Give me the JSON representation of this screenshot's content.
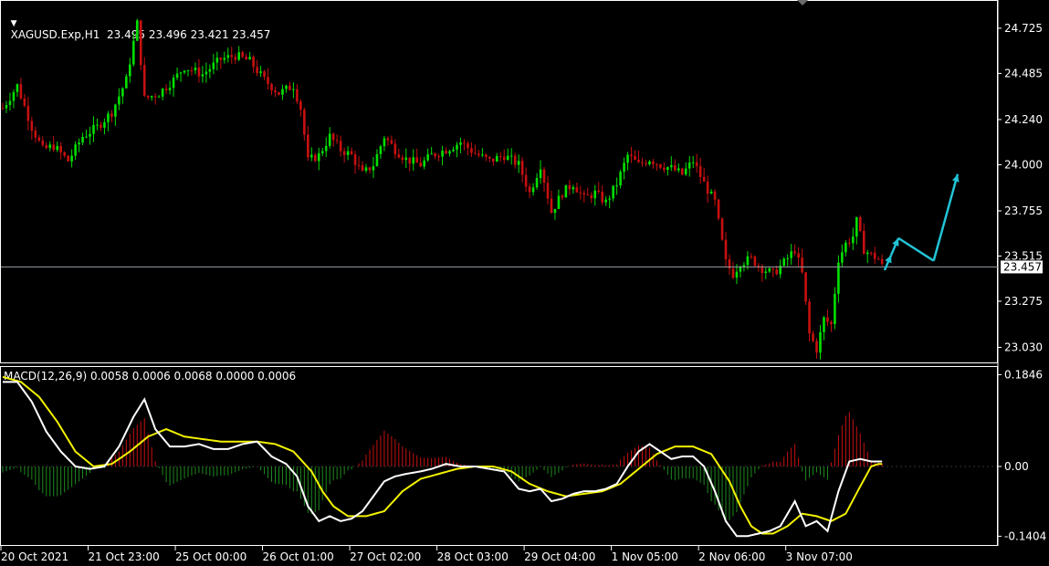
{
  "header": {
    "symbol_line": "XAGUSD.Exp,H1  23.495 23.496 23.421 23.457",
    "indicator_line": "MACD(12,26,9) 0.0058 0.0006 0.0068 0.0000 0.0006"
  },
  "colors": {
    "background": "#000000",
    "frame": "#ffffff",
    "bull": "#00e000",
    "bear": "#c81010",
    "price_line": "#9aa0a6",
    "forecast_arrow": "#22c3d6",
    "macd_line": "#ffffff",
    "signal_line": "#f2f200",
    "hist_pos": "#c81010",
    "hist_neg": "#1f8a1f"
  },
  "chart_data": [
    {
      "type": "candlestick",
      "title": "XAGUSD.Exp,H1",
      "ylim": [
        22.95,
        24.87
      ],
      "y_ticks": [
        "24.725",
        "24.485",
        "24.240",
        "24.000",
        "23.755",
        "23.515",
        "23.275",
        "23.030"
      ],
      "y_tick_values": [
        24.725,
        24.485,
        24.24,
        24.0,
        23.755,
        23.515,
        23.275,
        23.03
      ],
      "current_price": "23.457",
      "current_price_value": 23.457,
      "x_ticks": [
        "20 Oct 2021",
        "21 Oct 23:00",
        "25 Oct 00:00",
        "26 Oct 01:00",
        "27 Oct 02:00",
        "28 Oct 03:00",
        "29 Oct 04:00",
        "1 Nov 05:00",
        "2 Nov 06:00",
        "3 Nov 07:00"
      ],
      "x_tick_index": [
        0,
        24,
        48,
        72,
        96,
        120,
        144,
        168,
        192,
        216
      ],
      "close_path_anchors": [
        [
          0,
          24.3
        ],
        [
          4,
          24.42
        ],
        [
          8,
          24.2
        ],
        [
          11,
          24.08
        ],
        [
          14,
          24.1
        ],
        [
          18,
          24.02
        ],
        [
          22,
          24.15
        ],
        [
          26,
          24.2
        ],
        [
          30,
          24.28
        ],
        [
          34,
          24.45
        ],
        [
          37,
          24.75
        ],
        [
          39,
          24.35
        ],
        [
          43,
          24.38
        ],
        [
          47,
          24.45
        ],
        [
          50,
          24.52
        ],
        [
          55,
          24.48
        ],
        [
          60,
          24.56
        ],
        [
          64,
          24.58
        ],
        [
          68,
          24.55
        ],
        [
          72,
          24.45
        ],
        [
          76,
          24.38
        ],
        [
          80,
          24.42
        ],
        [
          82,
          24.3
        ],
        [
          84,
          24.02
        ],
        [
          87,
          24.05
        ],
        [
          90,
          24.15
        ],
        [
          93,
          24.08
        ],
        [
          96,
          24.05
        ],
        [
          99,
          23.95
        ],
        [
          102,
          24.0
        ],
        [
          105,
          24.15
        ],
        [
          108,
          24.08
        ],
        [
          111,
          24.03
        ],
        [
          115,
          24.0
        ],
        [
          118,
          24.05
        ],
        [
          122,
          24.08
        ],
        [
          126,
          24.12
        ],
        [
          130,
          24.06
        ],
        [
          134,
          24.02
        ],
        [
          138,
          24.05
        ],
        [
          142,
          24.0
        ],
        [
          145,
          23.85
        ],
        [
          148,
          24.0
        ],
        [
          151,
          23.75
        ],
        [
          154,
          23.85
        ],
        [
          157,
          23.9
        ],
        [
          160,
          23.82
        ],
        [
          163,
          23.85
        ],
        [
          166,
          23.8
        ],
        [
          169,
          23.9
        ],
        [
          172,
          24.05
        ],
        [
          175,
          24.0
        ],
        [
          178,
          24.03
        ],
        [
          181,
          24.0
        ],
        [
          184,
          23.98
        ],
        [
          187,
          23.95
        ],
        [
          190,
          24.02
        ],
        [
          193,
          23.9
        ],
        [
          196,
          23.8
        ],
        [
          199,
          23.48
        ],
        [
          201,
          23.42
        ],
        [
          203,
          23.48
        ],
        [
          206,
          23.5
        ],
        [
          209,
          23.45
        ],
        [
          212,
          23.42
        ],
        [
          215,
          23.48
        ],
        [
          218,
          23.55
        ],
        [
          220,
          23.42
        ],
        [
          222,
          23.1
        ],
        [
          224,
          23.02
        ],
        [
          226,
          23.18
        ],
        [
          228,
          23.15
        ],
        [
          230,
          23.5
        ],
        [
          232,
          23.58
        ],
        [
          234,
          23.62
        ],
        [
          235,
          23.7
        ],
        [
          237,
          23.55
        ],
        [
          239,
          23.52
        ],
        [
          241,
          23.5
        ],
        [
          242,
          23.46
        ]
      ],
      "forecast_path": [
        [
          242.7,
          23.44
        ],
        [
          244.5,
          23.52
        ],
        [
          246.5,
          23.61
        ],
        [
          256.2,
          23.49
        ],
        [
          262.8,
          23.95
        ]
      ]
    },
    {
      "type": "line",
      "title": "MACD(12,26,9)",
      "ylim": [
        -0.158,
        0.2
      ],
      "y_ticks": [
        "0.1846",
        "0.00",
        "-0.1404"
      ],
      "y_tick_values": [
        0.1846,
        0.0,
        -0.1404
      ],
      "series": [
        {
          "role": "macd",
          "anchors": [
            [
              0,
              0.17
            ],
            [
              4,
              0.17
            ],
            [
              8,
              0.13
            ],
            [
              12,
              0.07
            ],
            [
              16,
              0.03
            ],
            [
              20,
              0.0
            ],
            [
              24,
              -0.005
            ],
            [
              28,
              0.0
            ],
            [
              32,
              0.04
            ],
            [
              36,
              0.1
            ],
            [
              39,
              0.135
            ],
            [
              42,
              0.075
            ],
            [
              46,
              0.04
            ],
            [
              50,
              0.04
            ],
            [
              54,
              0.045
            ],
            [
              58,
              0.035
            ],
            [
              62,
              0.035
            ],
            [
              66,
              0.045
            ],
            [
              70,
              0.05
            ],
            [
              74,
              0.02
            ],
            [
              78,
              0.005
            ],
            [
              81,
              -0.02
            ],
            [
              84,
              -0.08
            ],
            [
              87,
              -0.11
            ],
            [
              90,
              -0.1
            ],
            [
              93,
              -0.11
            ],
            [
              96,
              -0.105
            ],
            [
              99,
              -0.09
            ],
            [
              102,
              -0.06
            ],
            [
              105,
              -0.03
            ],
            [
              108,
              -0.02
            ],
            [
              111,
              -0.015
            ],
            [
              115,
              -0.01
            ],
            [
              118,
              -0.005
            ],
            [
              122,
              0.005
            ],
            [
              126,
              0.0
            ],
            [
              130,
              0.0
            ],
            [
              134,
              -0.005
            ],
            [
              138,
              -0.01
            ],
            [
              142,
              -0.045
            ],
            [
              145,
              -0.05
            ],
            [
              148,
              -0.045
            ],
            [
              151,
              -0.07
            ],
            [
              154,
              -0.065
            ],
            [
              157,
              -0.055
            ],
            [
              160,
              -0.05
            ],
            [
              163,
              -0.05
            ],
            [
              166,
              -0.045
            ],
            [
              169,
              -0.035
            ],
            [
              172,
              0.0
            ],
            [
              175,
              0.03
            ],
            [
              178,
              0.045
            ],
            [
              181,
              0.03
            ],
            [
              184,
              0.015
            ],
            [
              187,
              0.02
            ],
            [
              190,
              0.02
            ],
            [
              193,
              0.0
            ],
            [
              196,
              -0.05
            ],
            [
              199,
              -0.11
            ],
            [
              202,
              -0.14
            ],
            [
              205,
              -0.14
            ],
            [
              208,
              -0.135
            ],
            [
              211,
              -0.13
            ],
            [
              214,
              -0.12
            ],
            [
              218,
              -0.07
            ],
            [
              221,
              -0.12
            ],
            [
              224,
              -0.11
            ],
            [
              227,
              -0.13
            ],
            [
              230,
              -0.05
            ],
            [
              233,
              0.01
            ],
            [
              236,
              0.015
            ],
            [
              239,
              0.01
            ],
            [
              241,
              0.01
            ]
          ]
        },
        {
          "role": "signal",
          "anchors": [
            [
              0,
              0.18
            ],
            [
              5,
              0.17
            ],
            [
              10,
              0.14
            ],
            [
              15,
              0.09
            ],
            [
              20,
              0.03
            ],
            [
              25,
              0.0
            ],
            [
              30,
              0.005
            ],
            [
              35,
              0.03
            ],
            [
              40,
              0.06
            ],
            [
              45,
              0.075
            ],
            [
              50,
              0.06
            ],
            [
              55,
              0.055
            ],
            [
              60,
              0.05
            ],
            [
              65,
              0.05
            ],
            [
              70,
              0.05
            ],
            [
              75,
              0.045
            ],
            [
              80,
              0.03
            ],
            [
              85,
              -0.01
            ],
            [
              88,
              -0.05
            ],
            [
              91,
              -0.08
            ],
            [
              95,
              -0.1
            ],
            [
              100,
              -0.1
            ],
            [
              105,
              -0.09
            ],
            [
              110,
              -0.05
            ],
            [
              115,
              -0.025
            ],
            [
              120,
              -0.015
            ],
            [
              125,
              -0.005
            ],
            [
              130,
              0.0
            ],
            [
              135,
              0.0
            ],
            [
              140,
              -0.01
            ],
            [
              145,
              -0.035
            ],
            [
              150,
              -0.05
            ],
            [
              155,
              -0.06
            ],
            [
              160,
              -0.055
            ],
            [
              165,
              -0.05
            ],
            [
              170,
              -0.035
            ],
            [
              175,
              -0.005
            ],
            [
              180,
              0.025
            ],
            [
              185,
              0.04
            ],
            [
              190,
              0.04
            ],
            [
              195,
              0.025
            ],
            [
              200,
              -0.03
            ],
            [
              203,
              -0.08
            ],
            [
              206,
              -0.12
            ],
            [
              209,
              -0.135
            ],
            [
              212,
              -0.135
            ],
            [
              216,
              -0.12
            ],
            [
              220,
              -0.095
            ],
            [
              224,
              -0.1
            ],
            [
              228,
              -0.11
            ],
            [
              232,
              -0.095
            ],
            [
              236,
              -0.04
            ],
            [
              239,
              0.0
            ],
            [
              241,
              0.005
            ]
          ]
        }
      ]
    }
  ]
}
